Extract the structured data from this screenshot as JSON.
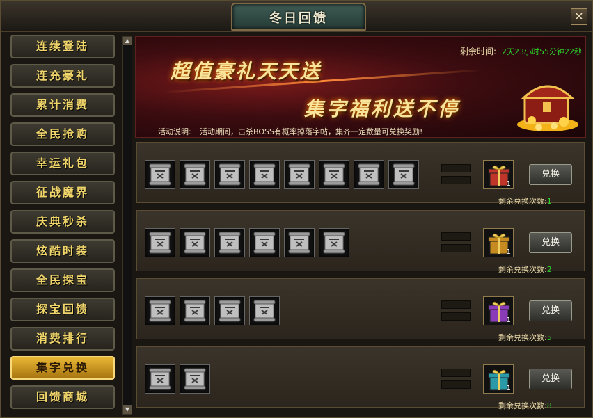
{
  "window": {
    "title": "冬日回馈",
    "close_label": "✕"
  },
  "sidebar": {
    "items": [
      {
        "label": "连续登陆",
        "active": false
      },
      {
        "label": "连充豪礼",
        "active": false
      },
      {
        "label": "累计消费",
        "active": false
      },
      {
        "label": "全民抢购",
        "active": false
      },
      {
        "label": "幸运礼包",
        "active": false
      },
      {
        "label": "征战魔界",
        "active": false
      },
      {
        "label": "庆典秒杀",
        "active": false
      },
      {
        "label": "炫酷时装",
        "active": false
      },
      {
        "label": "全民探宝",
        "active": false
      },
      {
        "label": "探宝回馈",
        "active": false
      },
      {
        "label": "消费排行",
        "active": false
      },
      {
        "label": "集字兑换",
        "active": true
      },
      {
        "label": "回馈商城",
        "active": false
      }
    ]
  },
  "banner": {
    "remaining_label": "剩余时间:",
    "remaining_value": "2天23小时55分钟22秒",
    "headline1": "超值豪礼天天送",
    "headline2": "集字福利送不停",
    "desc_label": "活动说明:",
    "desc": "活动期间，击杀BOSS有概率掉落字帖，集齐一定数量可兑换奖励!"
  },
  "rows": [
    {
      "scrolls": 8,
      "gift_count": "1",
      "gift_color": "#c0352a",
      "button": "兑换",
      "remain_label": "剩余兑换次数:",
      "remain_value": "1"
    },
    {
      "scrolls": 6,
      "gift_count": "1",
      "gift_color": "#c58a20",
      "button": "兑换",
      "remain_label": "剩余兑换次数:",
      "remain_value": "2"
    },
    {
      "scrolls": 4,
      "gift_count": "1",
      "gift_color": "#8a3bb8",
      "button": "兑换",
      "remain_label": "剩余兑换次数:",
      "remain_value": "5"
    },
    {
      "scrolls": 2,
      "gift_count": "1",
      "gift_color": "#2a9aa8",
      "button": "兑换",
      "remain_label": "剩余兑换次数:",
      "remain_value": "8"
    }
  ],
  "icons": {
    "scroll": "scroll-icon",
    "gift": "gift-box-icon",
    "chest": "treasure-chest-icon"
  }
}
